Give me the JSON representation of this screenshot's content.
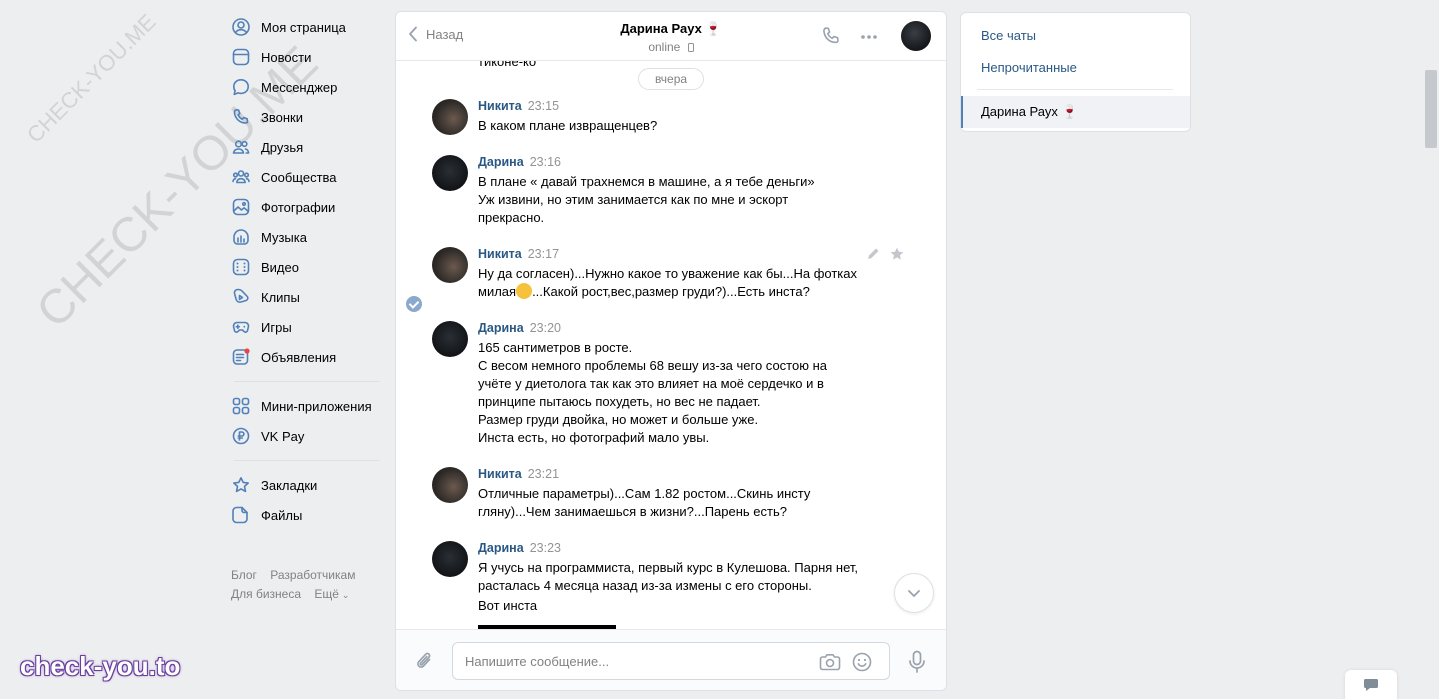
{
  "watermark": {
    "small": "CHECK-YOU.ME",
    "large": "CHECK-YOU.ME",
    "brand": "check-you.to"
  },
  "leftnav": {
    "items": [
      {
        "label": "Моя страница",
        "icon": "user-circle-icon"
      },
      {
        "label": "Новости",
        "icon": "news-icon"
      },
      {
        "label": "Мессенджер",
        "icon": "message-icon"
      },
      {
        "label": "Звонки",
        "icon": "phone-icon"
      },
      {
        "label": "Друзья",
        "icon": "friends-icon"
      },
      {
        "label": "Сообщества",
        "icon": "communities-icon"
      },
      {
        "label": "Фотографии",
        "icon": "photo-icon"
      },
      {
        "label": "Музыка",
        "icon": "music-icon"
      },
      {
        "label": "Видео",
        "icon": "video-icon"
      },
      {
        "label": "Клипы",
        "icon": "clips-icon"
      },
      {
        "label": "Игры",
        "icon": "gamepad-icon"
      },
      {
        "label": "Объявления",
        "icon": "ads-icon"
      }
    ],
    "items2": [
      {
        "label": "Мини-приложения",
        "icon": "apps-icon"
      },
      {
        "label": "VK Pay",
        "icon": "vkpay-icon"
      }
    ],
    "items3": [
      {
        "label": "Закладки",
        "icon": "star-icon"
      },
      {
        "label": "Файлы",
        "icon": "file-icon"
      }
    ],
    "footer": {
      "blog": "Блог",
      "devs": "Разработчикам",
      "business": "Для бизнеса",
      "more": "Ещё"
    }
  },
  "chat": {
    "back_label": "Назад",
    "peer_name": "Дарина Раух 🍷",
    "peer_status": "online",
    "cut_text": "тиконе-ко",
    "date_separator": "вчера",
    "messages": [
      {
        "author": "Никита",
        "time": "23:15",
        "text": "В каком плане извращенцев?"
      },
      {
        "author": "Дарина",
        "time": "23:16",
        "text": "В плане « давай трахнемся в машине, а я тебе деньги»\nУж извини, но этим занимается как по мне и эскорт\nпрекрасно."
      },
      {
        "author": "Никита",
        "time": "23:17",
        "text_a": "Ну да согласен)...Нужно какое то уважение как бы...На фотках\nмилая",
        "text_b": "...Какой рост,вес,размер груди?)...Есть инста?"
      },
      {
        "author": "Дарина",
        "time": "23:20",
        "text": "165 сантиметров в росте.\nС весом немного проблемы 68 вешу из-за чего состою на\nучёте у диетолога так как это влияет на моё сердечко и в\nпринципе пытаюсь похудеть, но вес не падает.\nРазмер груди двойка, но может и больше уже.\nИнста есть, но фотографий мало увы."
      },
      {
        "author": "Никита",
        "time": "23:21",
        "text": "Отличные параметры)...Сам 1.82 ростом...Скинь инсту\nгляну)...Чем занимаешься в жизни?...Парень есть?"
      },
      {
        "author": "Дарина",
        "time": "23:23",
        "text": "Я учусь на программиста, первый курс в Кулешова. Парня нет,\nрасталась 4 месяца назад из-за измены с его стороны."
      }
    ],
    "extra_text": "Вот инста",
    "composer": {
      "placeholder": "Напишите сообщение..."
    }
  },
  "rightpanel": {
    "all_chats": "Все чаты",
    "unread": "Непрочитанные",
    "active_chat": "Дарина Раух 🍷"
  },
  "colors": {
    "accent": "#5181b8",
    "link": "#2a5885",
    "bg": "#edeef0"
  }
}
